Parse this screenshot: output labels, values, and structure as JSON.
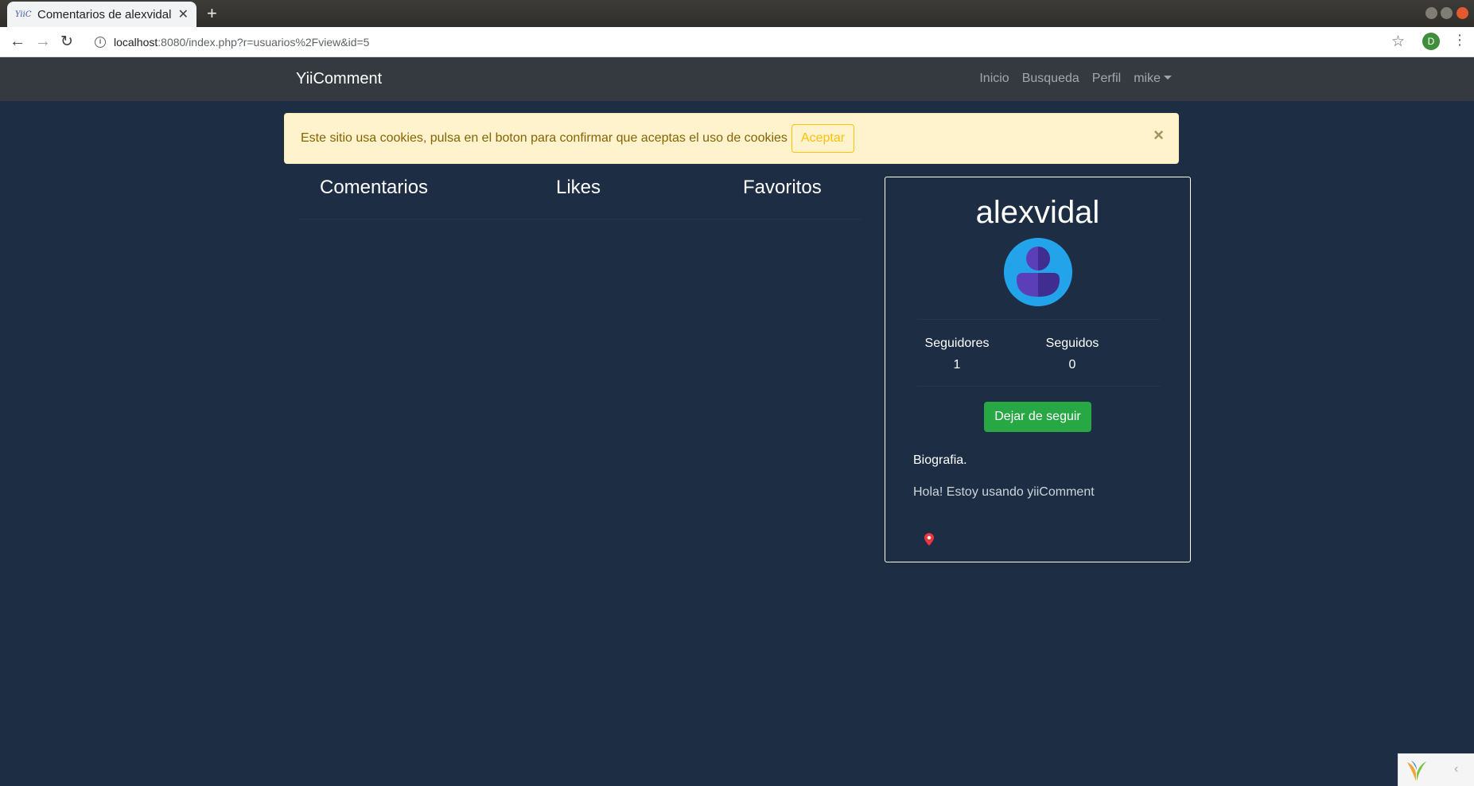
{
  "browser": {
    "tab_favicon": "YiiC",
    "tab_title": "Comentarios de alexvidal",
    "tab_close": "✕",
    "new_tab": "+",
    "url_host": "localhost",
    "url_rest": ":8080/index.php?r=usuarios%2Fview&id=5",
    "profile_initial": "D"
  },
  "navbar": {
    "brand": "YiiComment",
    "links": [
      "Inicio",
      "Busqueda",
      "Perfil",
      "mike"
    ]
  },
  "alert": {
    "text": "Este sitio usa cookies, pulsa en el boton para confirmar que aceptas el uso de cookies",
    "accept": "Aceptar",
    "close": "×"
  },
  "tabs": [
    "Comentarios",
    "Likes",
    "Favoritos"
  ],
  "profile": {
    "username": "alexvidal",
    "followers_label": "Seguidores",
    "followers": "1",
    "following_label": "Seguidos",
    "following": "0",
    "unfollow": "Dejar de seguir",
    "bio_label": "Biografia.",
    "bio": "Hola! Estoy usando yiiComment"
  },
  "colors": {
    "page_bg": "#1c2d44",
    "navbar_bg": "#343a40",
    "alert_bg": "#fff3cd",
    "success": "#28a745",
    "avatar": "#22a3ea"
  }
}
